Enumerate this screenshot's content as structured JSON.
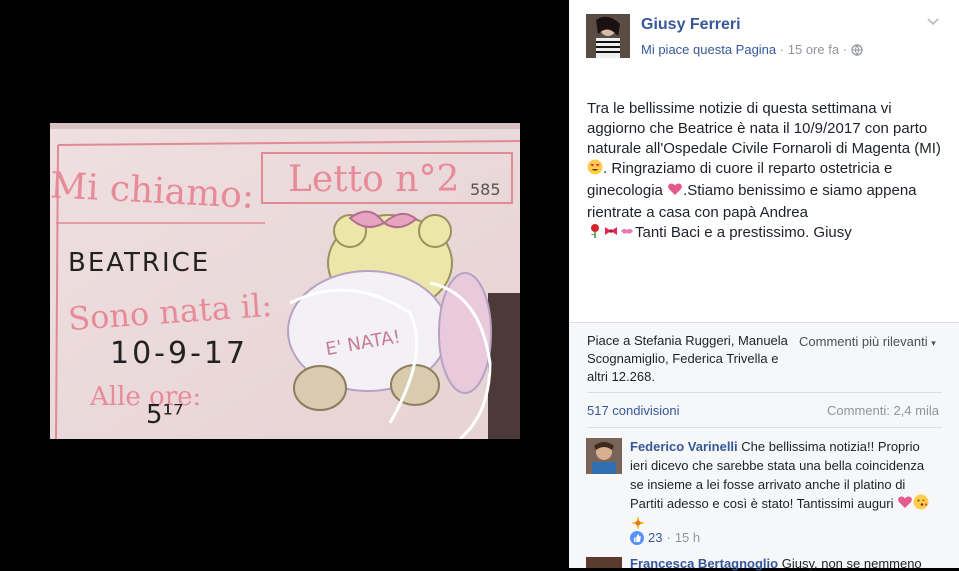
{
  "post": {
    "author": "Giusy Ferreri",
    "like_page": "Mi piace questa Pagina",
    "time": "15 ore fa",
    "separator": "·",
    "text_1": "Tra le bellissime notizie di questa settimana vi aggiorno che Beatrice è nata il 10/9/2017 con parto naturale all'Ospedale Civile Fornaroli di Magenta (MI)",
    "text_2": ". Ringraziamo di cuore il reparto ostetricia e ginecologia ",
    "text_3": ".Stiamo benissimo e siamo appena rientrate a casa con papà Andrea",
    "text_4": "Tanti Baci e a prestissimo. Giusy"
  },
  "photo": {
    "line_1": "Mi chiamo:",
    "bed": "Letto n°2",
    "code": "585",
    "name": "BEATRICE",
    "line_2": "Sono nata il:",
    "date": "10-9-17",
    "line_3": "Alle ore:",
    "hour": "5¹⁷",
    "badge": "E' NATA!"
  },
  "reactions": {
    "likes": "Piace a Stefania Ruggeri, Manuela Scognamiglio, Federica Trivella e altri 12.268.",
    "sort": "Commenti più rilevanti",
    "shares": "517 condivisioni",
    "comments": "Commenti: 2,4 mila"
  },
  "comments": [
    {
      "author": "Federico Varinelli",
      "text": " Che bellissima notizia!! Proprio ieri dicevo che sarebbe stata una bella coincidenza se insieme a lei fosse arrivato anche il platino di Partiti adesso e così è stato! Tantissimi auguri ",
      "likes": "23",
      "time": "15 h"
    },
    {
      "author": "Francesca Bertagnoglio",
      "text": " Giusy, non se nemmeno"
    }
  ],
  "colors": {
    "link": "#365899",
    "grey_text": "#90949c",
    "panel_bg": "#f6f7f9",
    "like_blue": "#5890ff"
  }
}
